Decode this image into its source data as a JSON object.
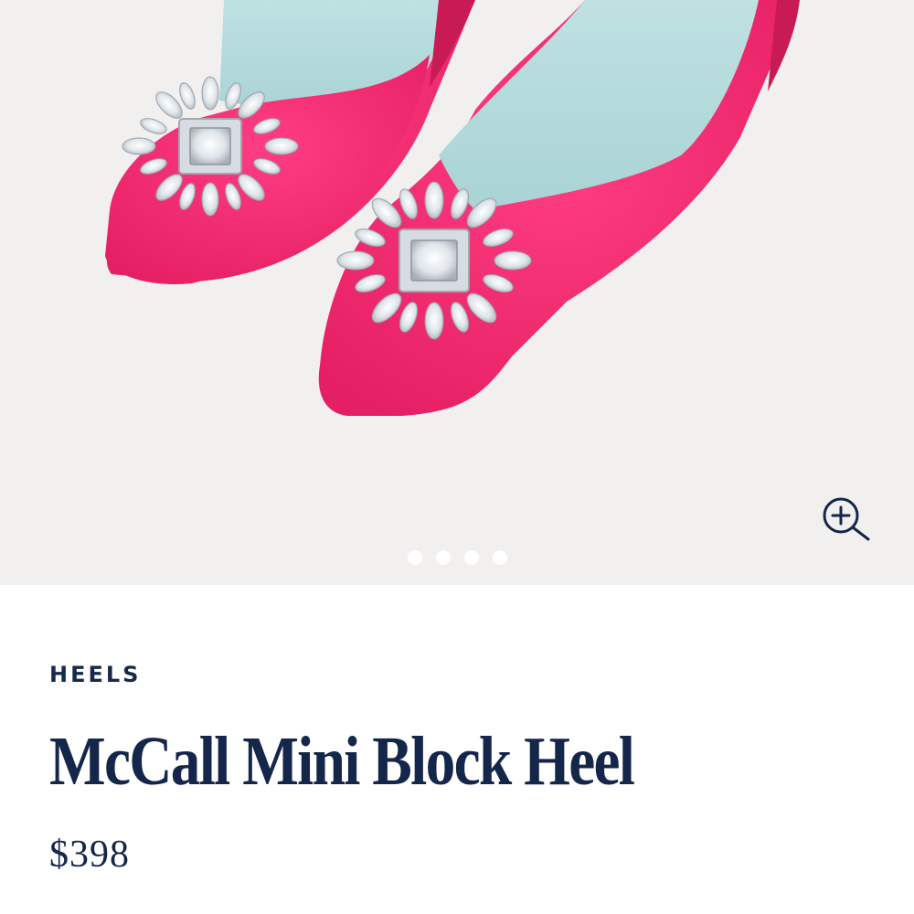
{
  "gallery": {
    "image_alt": "Pink velvet mini block heels with crystal brooch embellishments",
    "zoom_icon": "zoom-in-icon",
    "slide_count": 4,
    "colors": {
      "background": "#f2f0ef",
      "velvet": "#f22c72",
      "lining": "#b5dbdb",
      "crystal": "#e6ebef"
    }
  },
  "product": {
    "category": "HEELS",
    "title": "McCall Mini Block Heel",
    "price": "$398"
  },
  "colors": {
    "text": "#14264a",
    "dot": "#ffffff"
  }
}
